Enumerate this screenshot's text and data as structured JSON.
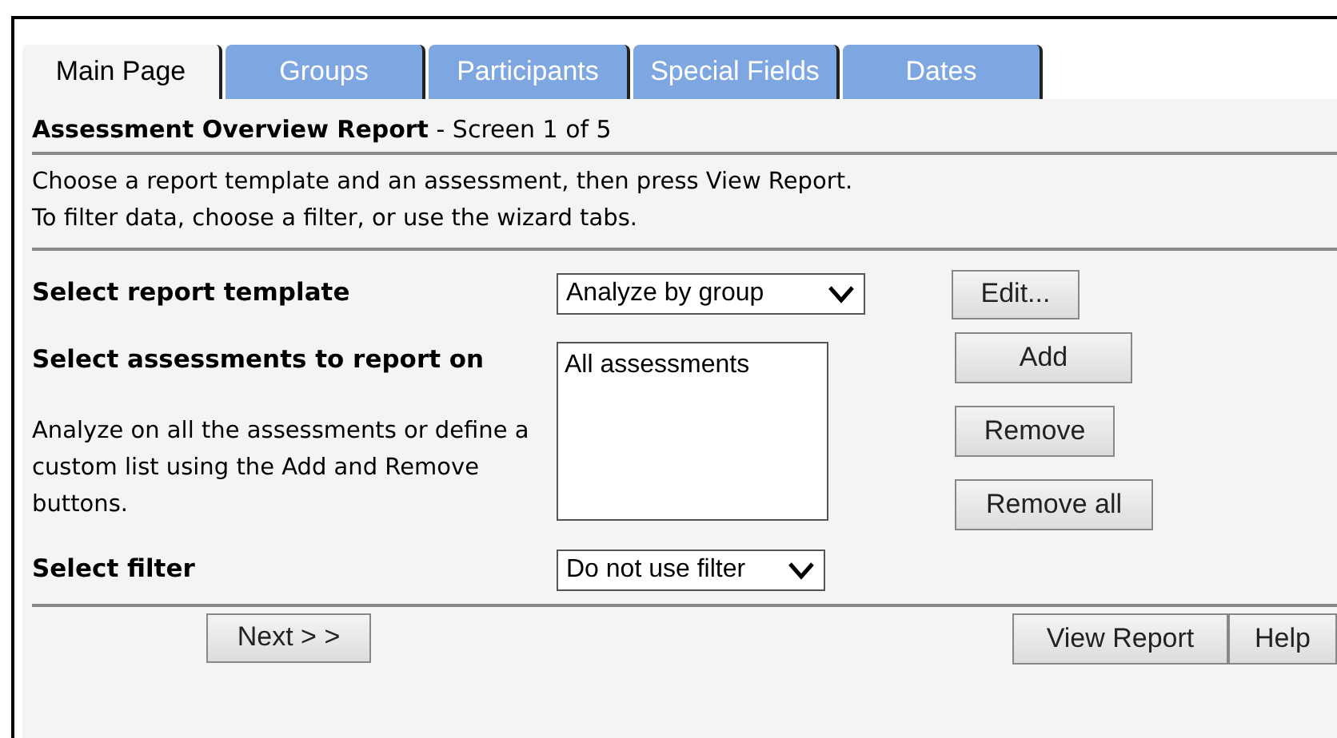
{
  "tabs": [
    {
      "label": "Main Page",
      "selected": true
    },
    {
      "label": "Groups",
      "selected": false
    },
    {
      "label": "Participants",
      "selected": false
    },
    {
      "label": "Special Fields",
      "selected": false
    },
    {
      "label": "Dates",
      "selected": false
    }
  ],
  "header": {
    "title": "Assessment Overview Report",
    "subtitle": "- Screen 1 of 5"
  },
  "instructions": [
    "Choose a report template and an assessment, then press View Report.",
    "To filter data, choose a filter, or use the wizard tabs."
  ],
  "template": {
    "label": "Select report template",
    "value": "Analyze by group",
    "button": "Edit..."
  },
  "assessments": {
    "label": "Select assessments to report on",
    "help": "Analyze on all the assessments or define a custom list using the Add and Remove buttons.",
    "items": [
      "All assessments"
    ],
    "buttons": [
      "Add",
      "Remove",
      "Remove all"
    ]
  },
  "filter": {
    "label": "Select filter",
    "value": "Do not use filter"
  },
  "footer": {
    "next": "Next > >",
    "buttons": [
      "View Report",
      "Help"
    ]
  }
}
